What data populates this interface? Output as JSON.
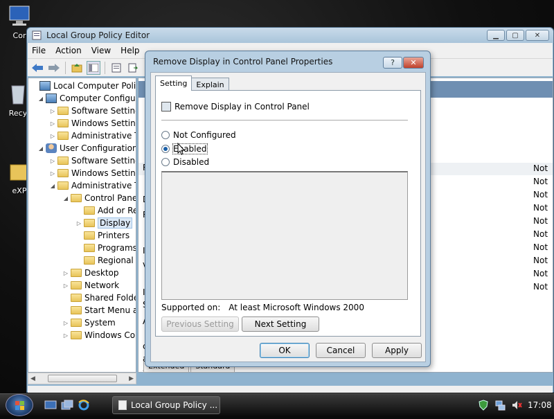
{
  "desktop": {
    "icons": [
      {
        "name": "computer-desktop-icon",
        "label": "Cor"
      },
      {
        "name": "recycle-bin-desktop-icon",
        "label": "Recy"
      },
      {
        "name": "explorer-desktop-icon",
        "label": "eXP"
      }
    ]
  },
  "mmc": {
    "title": "Local Group Policy Editor",
    "menu": [
      "File",
      "Action",
      "View",
      "Help"
    ],
    "tree": [
      {
        "label": "Local Computer Policy",
        "level": 0,
        "arrow": "",
        "icon": "computer"
      },
      {
        "label": "Computer Configura",
        "level": 1,
        "arrow": "◢",
        "icon": "computer"
      },
      {
        "label": "Software Settings",
        "level": 2,
        "arrow": "▷",
        "icon": "folder"
      },
      {
        "label": "Windows Setting",
        "level": 2,
        "arrow": "▷",
        "icon": "folder"
      },
      {
        "label": "Administrative Te",
        "level": 2,
        "arrow": "▷",
        "icon": "folder"
      },
      {
        "label": "User Configuration",
        "level": 1,
        "arrow": "◢",
        "icon": "user"
      },
      {
        "label": "Software Settings",
        "level": 2,
        "arrow": "▷",
        "icon": "folder"
      },
      {
        "label": "Windows Setting",
        "level": 2,
        "arrow": "▷",
        "icon": "folder"
      },
      {
        "label": "Administrative Te",
        "level": 2,
        "arrow": "◢",
        "icon": "folder"
      },
      {
        "label": "Control Panel",
        "level": 3,
        "arrow": "◢",
        "icon": "folder"
      },
      {
        "label": "Add or Re",
        "level": 4,
        "arrow": "",
        "icon": "folder"
      },
      {
        "label": "Display",
        "level": 4,
        "arrow": "▷",
        "icon": "folder",
        "selected": true
      },
      {
        "label": "Printers",
        "level": 4,
        "arrow": "",
        "icon": "folder"
      },
      {
        "label": "Programs",
        "level": 4,
        "arrow": "",
        "icon": "folder"
      },
      {
        "label": "Regional a",
        "level": 4,
        "arrow": "",
        "icon": "folder"
      },
      {
        "label": "Desktop",
        "level": 3,
        "arrow": "▷",
        "icon": "folder"
      },
      {
        "label": "Network",
        "level": 3,
        "arrow": "▷",
        "icon": "folder"
      },
      {
        "label": "Shared Folder",
        "level": 3,
        "arrow": "",
        "icon": "folder"
      },
      {
        "label": "Start Menu ar",
        "level": 3,
        "arrow": "",
        "icon": "folder"
      },
      {
        "label": "System",
        "level": 3,
        "arrow": "▷",
        "icon": "folder"
      },
      {
        "label": "Windows Cor",
        "level": 3,
        "arrow": "▷",
        "icon": "folder"
      }
    ],
    "right_column": [
      "Not",
      "Not",
      "Not",
      "Not",
      "Not",
      "Not",
      "Not",
      "Not",
      "Not",
      "Not"
    ],
    "left_fragments": [
      "R",
      "D",
      "R",
      "I",
      "v",
      "I",
      "S",
      "A",
      "c",
      "a",
      "s"
    ],
    "bottom_tabs": [
      "Extended",
      "Standard"
    ]
  },
  "dialog": {
    "title": "Remove Display in Control Panel Properties",
    "tabs": [
      "Setting",
      "Explain"
    ],
    "policy_name": "Remove Display in Control Panel",
    "options": [
      "Not Configured",
      "Enabled",
      "Disabled"
    ],
    "selected_option": "Enabled",
    "supported_label": "Supported on:",
    "supported_value": "At least Microsoft Windows 2000",
    "previous_label": "Previous Setting",
    "next_label": "Next Setting",
    "ok_label": "OK",
    "cancel_label": "Cancel",
    "apply_label": "Apply"
  },
  "taskbar": {
    "task_label": "Local Group Policy ...",
    "clock": "17:08"
  }
}
